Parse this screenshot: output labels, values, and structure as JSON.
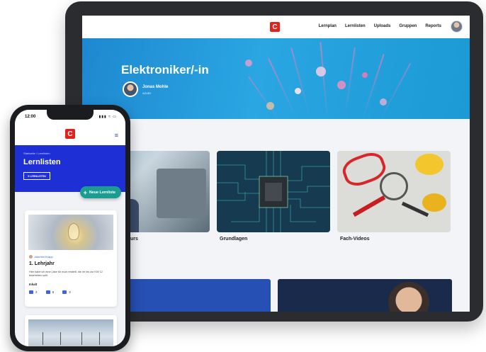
{
  "tablet": {
    "nav": {
      "logo": "C",
      "links": [
        "Lernplan",
        "Lernlisten",
        "Uploads",
        "Gruppen",
        "Reports"
      ]
    },
    "hero": {
      "title": "Elektroniker/-in",
      "user_name": "Jonas Mohle",
      "user_sub": "AZUBI"
    },
    "cards": [
      {
        "label": "urs"
      },
      {
        "label": "Grundlagen"
      },
      {
        "label": "Fach-Videos"
      }
    ]
  },
  "phone": {
    "status": {
      "time": "12:00",
      "signal": "▮▮▮ ≈ ▭"
    },
    "nav": {
      "logo": "C",
      "menu_icon": "≡"
    },
    "header": {
      "breadcrumb": "Startseite / Lernlisten",
      "title": "Lernlisten",
      "count_button": "5 LERNLISTEN"
    },
    "new_button": {
      "icon": "+",
      "label": "Neue Lernliste"
    },
    "card": {
      "author": "Joachim Krapp",
      "title": "1. Lehrjahr",
      "description": "Hier habe ich eine Liste für euch erstellt, die ihr bis zur KW 12 bearbeiten sollt.",
      "content_label": "Inhalt",
      "stats": [
        {
          "icon": "document-icon",
          "value": "2"
        },
        {
          "icon": "quiz-icon",
          "value": "6"
        },
        {
          "icon": "video-icon",
          "value": "3"
        }
      ]
    }
  },
  "colors": {
    "brand_red": "#e2231a",
    "hero_blue": "#2aa6e2",
    "phone_header_blue": "#1f2fd6",
    "accent_teal": "#1a9c93"
  }
}
